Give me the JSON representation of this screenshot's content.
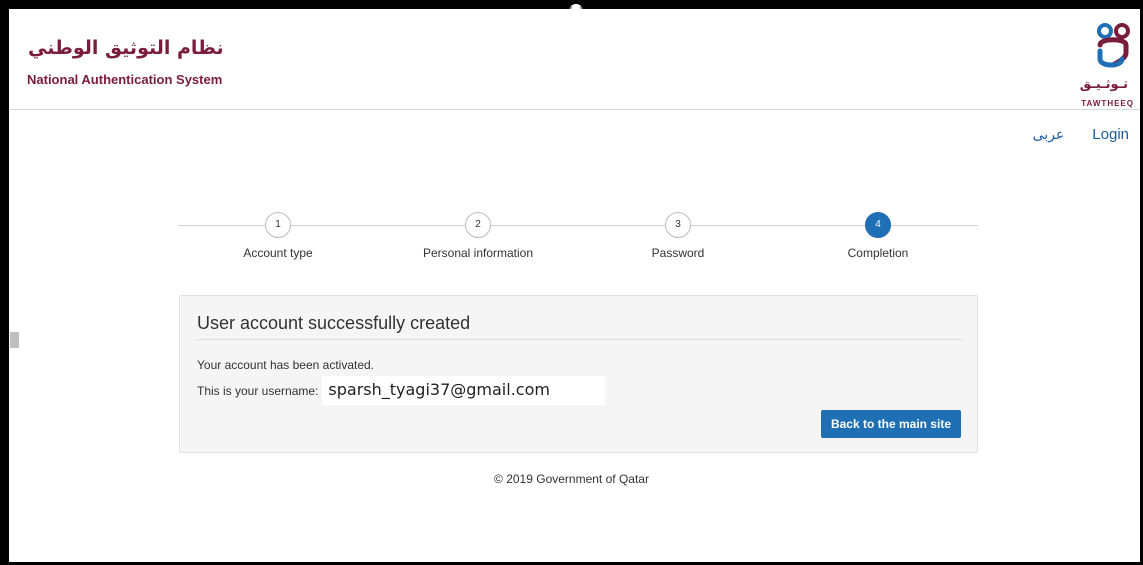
{
  "header": {
    "brand_ar": "نظام التوثيق الوطني",
    "brand_en": "National Authentication System",
    "logo_ar": "تـوثـيـق",
    "logo_en": "TAWTHEEQ"
  },
  "nav": {
    "language_label": "عربى",
    "login_label": "Login"
  },
  "stepper": {
    "steps": [
      {
        "number": "1",
        "label": "Account type",
        "active": false
      },
      {
        "number": "2",
        "label": "Personal information",
        "active": false
      },
      {
        "number": "3",
        "label": "Password",
        "active": false
      },
      {
        "number": "4",
        "label": "Completion",
        "active": true
      }
    ]
  },
  "card": {
    "title": "User account successfully created",
    "activated_text": "Your account has been activated.",
    "username_label": "This is your username:",
    "username_value": "sparsh_tyagi37@gmail.com",
    "back_button": "Back to the main site"
  },
  "footer": {
    "copyright": "© 2019 Government of Qatar"
  },
  "colors": {
    "brand": "#7a1c3c",
    "accent": "#1f6fb5",
    "link": "#1b5c9e"
  }
}
